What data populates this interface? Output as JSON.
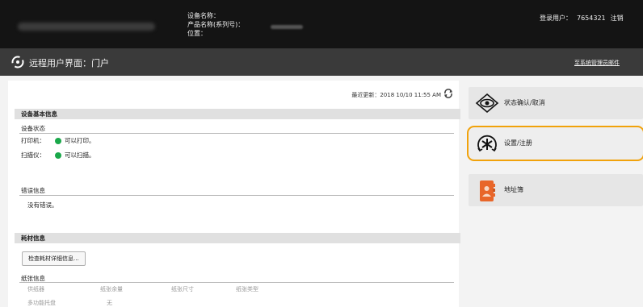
{
  "header": {
    "device_name_label": "设备名称：",
    "product_name_label": "产品名称(系列号)：",
    "location_label": "位置：",
    "login_user_label": "登录用户：",
    "login_user_value": "7654321",
    "logout_label": "注销"
  },
  "title_bar": {
    "title": "远程用户界面：门户",
    "language_link": "至系统管理员邮件"
  },
  "status": {
    "last_updated": "最近更新：2018 10/10 11:55 AM"
  },
  "device_basic_info": {
    "header": "设备基本信息",
    "device_status_header": "设备状态",
    "rows": [
      {
        "label": "打印机：",
        "status": "可以打印。"
      },
      {
        "label": "扫描仪：",
        "status": "可以扫描。"
      }
    ],
    "error_info_header": "错误信息",
    "error_info_text": "没有错误。"
  },
  "consumables": {
    "header": "耗材信息",
    "check_button": "检查耗材详细信息...",
    "paper_info_header": "纸张信息",
    "columns": [
      "供纸器",
      "纸张余量",
      "纸张尺寸",
      "纸张类型"
    ],
    "rows": [
      {
        "source": "多功能托盘",
        "level": "无"
      }
    ]
  },
  "menu": {
    "items": [
      {
        "label": "状态确认/取消",
        "icon": "eye-icon",
        "active": false
      },
      {
        "label": "设置/注册",
        "icon": "settings-icon",
        "active": true
      },
      {
        "label": "地址簿",
        "icon": "address-book-icon",
        "active": false
      }
    ]
  },
  "colors": {
    "header_bg": "#141414",
    "title_bar_bg": "#3a3a3a",
    "active_outline": "#f1a20b",
    "status_ok": "#1aa84a",
    "address_book_icon": "#e8662a"
  }
}
